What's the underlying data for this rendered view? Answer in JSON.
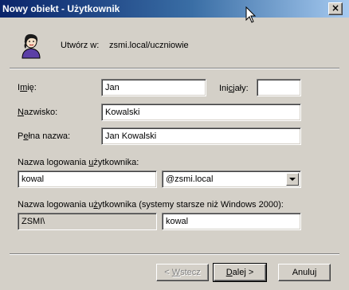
{
  "window": {
    "title": "Nowy obiekt - Użytkownik",
    "close_label": "×"
  },
  "header": {
    "create_in_label": "Utwórz w:",
    "create_in_path": "zsmi.local/uczniowie"
  },
  "form": {
    "first_name": {
      "label_pre": "I",
      "label_accel": "m",
      "label_post": "ię:",
      "value": "Jan"
    },
    "initials": {
      "label_pre": "Ini",
      "label_accel": "c",
      "label_post": "jały:",
      "value": ""
    },
    "last_name": {
      "label_pre": "",
      "label_accel": "N",
      "label_post": "azwisko:",
      "value": "Kowalski"
    },
    "full_name": {
      "label_pre": "P",
      "label_accel": "e",
      "label_post": "łna nazwa:",
      "value": "Jan Kowalski"
    },
    "logon_name": {
      "label_pre": "Nazwa logowania ",
      "label_accel": "u",
      "label_post": "żytkownika:",
      "value": "kowal",
      "domain_selected": "@zsmi.local"
    },
    "legacy_logon": {
      "label_pre": "Nazwa logowania u",
      "label_accel": "ż",
      "label_post": "ytkownika (systemy starsze niż Windows 2000):",
      "domain_prefix": "ZSMI\\",
      "value": "kowal"
    }
  },
  "buttons": {
    "back": {
      "pre": "< ",
      "accel": "W",
      "post": "stecz"
    },
    "next": {
      "pre": "",
      "accel": "D",
      "post": "alej >"
    },
    "cancel": {
      "label": "Anuluj"
    }
  },
  "colors": {
    "title_start": "#0a246a",
    "title_end": "#a6caf0",
    "face": "#d4d0c8"
  }
}
